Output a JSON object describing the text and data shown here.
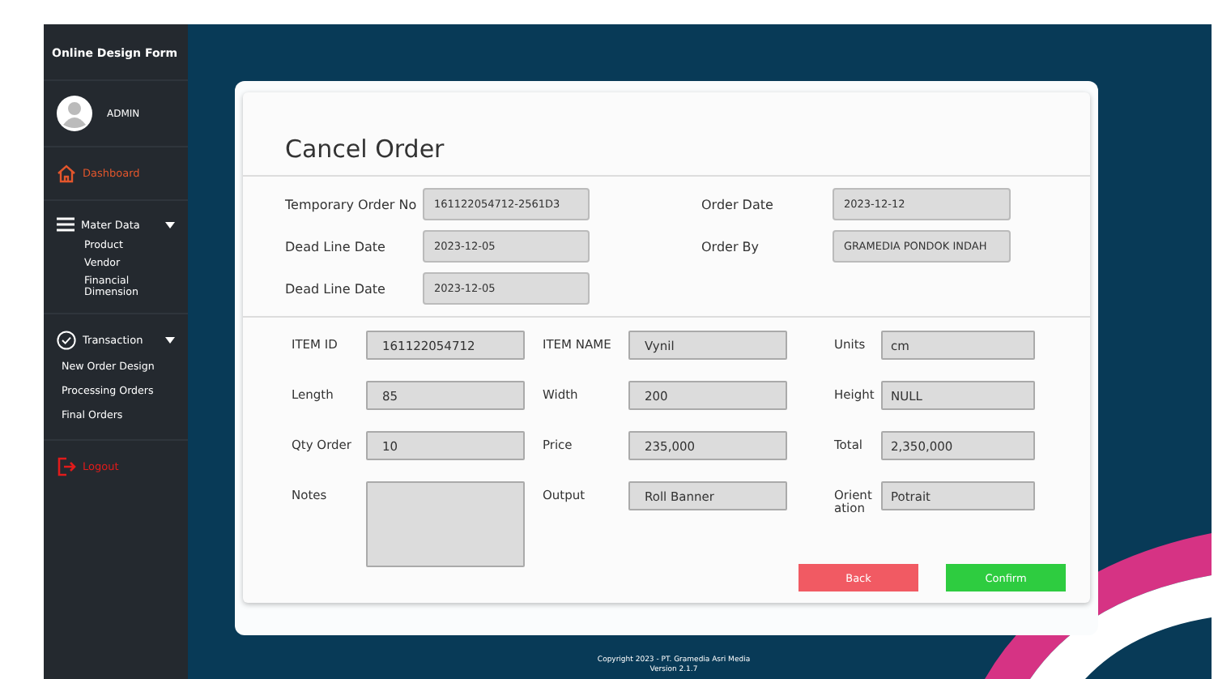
{
  "sidebar": {
    "title": "Online Design Form",
    "user": "ADMIN",
    "nav": [
      {
        "label": "Dashboard",
        "kind": "link",
        "selected": true
      },
      {
        "label": "Mater Data",
        "kind": "group",
        "expanded": true,
        "children": [
          {
            "label": "Product"
          },
          {
            "label": "Vendor"
          },
          {
            "label": "Financial Dimension"
          }
        ]
      },
      {
        "label": "Transaction",
        "kind": "group",
        "expanded": true,
        "children": [
          {
            "label": "New Order Design"
          },
          {
            "label": "Processing Orders"
          },
          {
            "label": "Final Orders"
          }
        ]
      },
      {
        "label": "Logout",
        "kind": "logout"
      }
    ]
  },
  "form": {
    "title": "Cancel Order",
    "header_fields": [
      {
        "label": "Temporary Order No",
        "value": "161122054712-2561D3"
      },
      {
        "label": "Order Date",
        "value": "2023-12-12"
      },
      {
        "label": "Dead Line Date",
        "value": "2023-12-05"
      },
      {
        "label": "Order By",
        "value": "GRAMEDIA PONDOK INDAH"
      },
      {
        "label": "Dead Line Date",
        "value": "2023-12-05"
      }
    ],
    "item_fields": [
      {
        "label": "ITEM ID",
        "value": "161122054712",
        "kind": "input"
      },
      {
        "label": "ITEM NAME",
        "value": "Vynil",
        "kind": "input"
      },
      {
        "label": "Units",
        "value": "cm",
        "kind": "input"
      },
      {
        "label": "Length",
        "value": "85",
        "kind": "input"
      },
      {
        "label": "Width",
        "value": "200",
        "kind": "input"
      },
      {
        "label": "Height",
        "value": "NULL",
        "kind": "input"
      },
      {
        "label": "Qty Order",
        "value": "10",
        "kind": "input"
      },
      {
        "label": "Price",
        "value": "235,000",
        "kind": "input"
      },
      {
        "label": "Total",
        "value": "2,350,000",
        "kind": "input"
      },
      {
        "label": "Notes",
        "kind": "textarea"
      },
      {
        "label": "Output",
        "value": "Roll Banner",
        "kind": "input"
      },
      {
        "label": "Orient ation",
        "value": "Potrait",
        "kind": "input"
      }
    ],
    "buttons": [
      {
        "label": "Back",
        "kind": "back"
      },
      {
        "label": "Confirm",
        "kind": "confirm"
      }
    ]
  },
  "footer": {
    "copyright": "Copyright 2023 - PT. Gramedia Asri Media",
    "version": "Version 2.1.7"
  }
}
